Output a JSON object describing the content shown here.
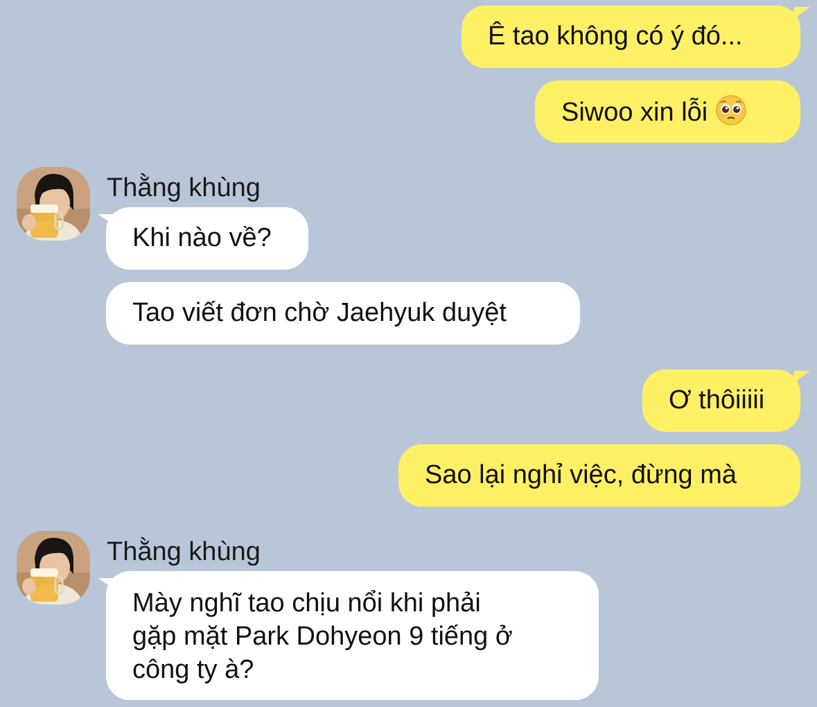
{
  "conversation": {
    "messages": [
      {
        "from": "me",
        "text": "Ê tao không có ý đó..."
      },
      {
        "from": "me",
        "text": "Siwoo xin lỗi",
        "emoji": "pleading-face-icon"
      },
      {
        "from": "them",
        "sender": "Thằng khùng",
        "text": "Khi nào về?"
      },
      {
        "from": "them",
        "text": "Tao viết đơn chờ Jaehyuk duyệt"
      },
      {
        "from": "me",
        "text": "Ơ thôiiiii"
      },
      {
        "from": "me",
        "text": "Sao lại nghỉ việc, đừng mà"
      },
      {
        "from": "them",
        "sender": "Thằng khùng",
        "lines": [
          "Mày nghĩ tao chịu nổi khi phải",
          "gặp mặt Park Dohyeon 9 tiếng ở",
          "công ty à?"
        ]
      }
    ]
  },
  "colors": {
    "background": "#b9c6d8",
    "my_bubble": "#fdf065",
    "their_bubble": "#ffffff"
  }
}
